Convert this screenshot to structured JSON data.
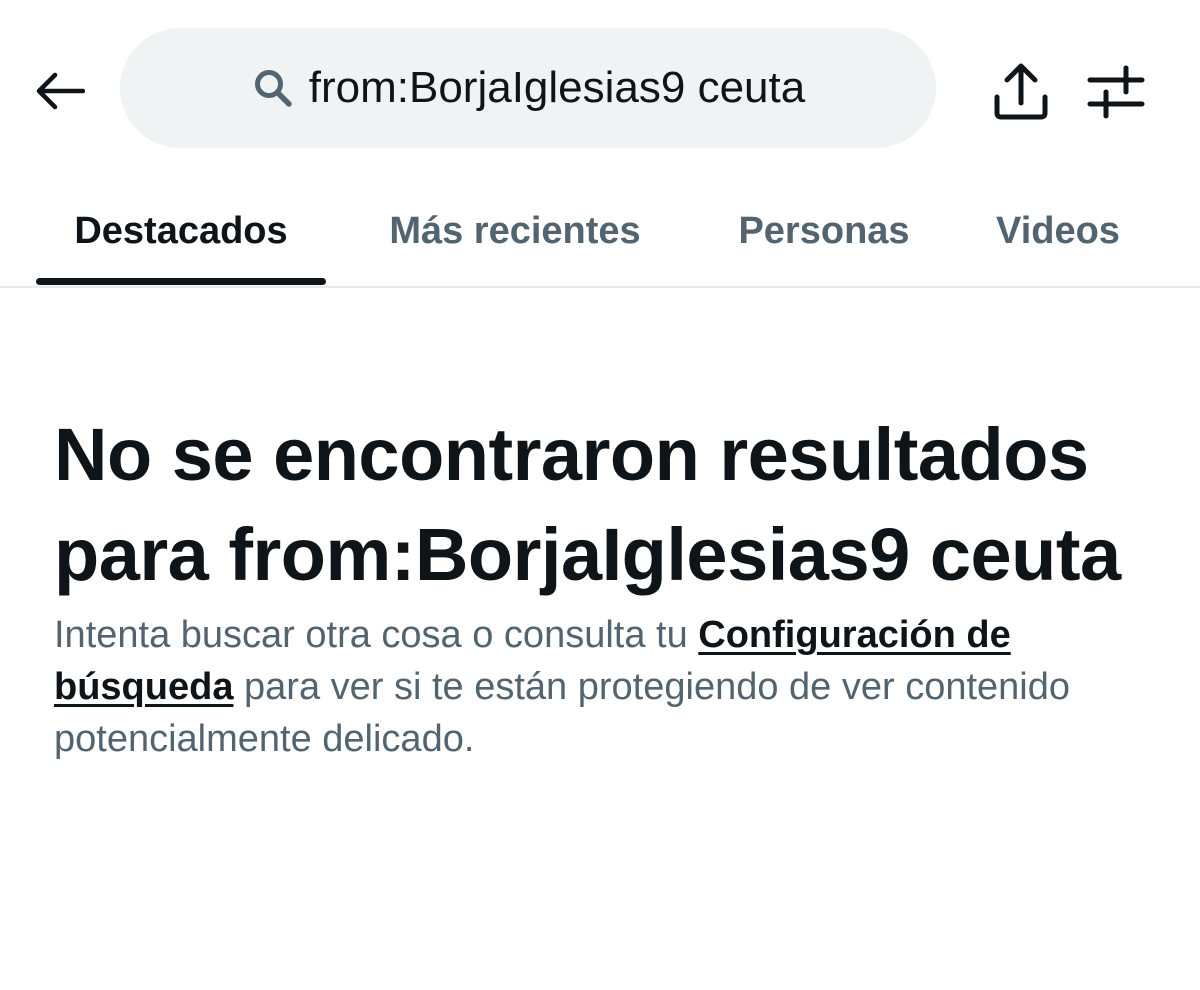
{
  "search": {
    "query": "from:BorjaIglesias9 ceuta",
    "icon": "search-icon"
  },
  "toolbar": {
    "back_icon": "back-arrow-icon",
    "share_icon": "share-icon",
    "filter_icon": "filter-sliders-icon"
  },
  "tabs": [
    {
      "label": "Destacados",
      "active": true
    },
    {
      "label": "Más recientes",
      "active": false
    },
    {
      "label": "Personas",
      "active": false
    },
    {
      "label": "Videos",
      "active": false
    }
  ],
  "empty_state": {
    "title": "No se encontraron resultados para from:BorjaIglesias9 ceuta",
    "body_before": "Intenta buscar otra cosa o consulta tu ",
    "link_label": "Configuración de búsqueda",
    "body_after": " para ver si te están protegiendo de ver contenido potencialmente delicado."
  },
  "colors": {
    "text_primary": "#0f1419",
    "text_secondary": "#536471",
    "search_background": "#eff3f4",
    "divider": "#e6e9eb"
  }
}
